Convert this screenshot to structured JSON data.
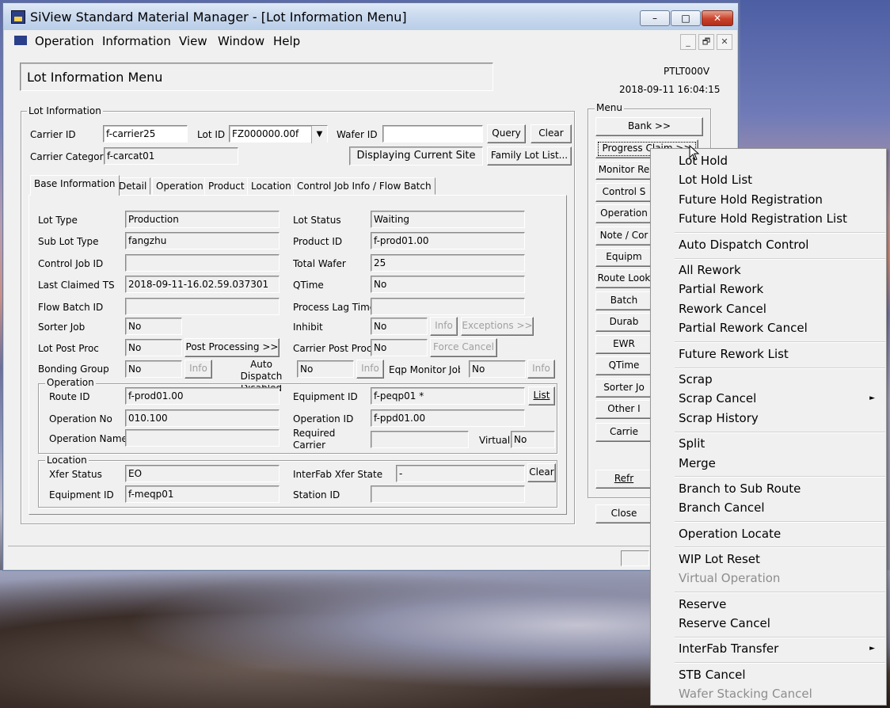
{
  "window": {
    "title": "SiView Standard Material Manager - [Lot Information Menu]",
    "menus": [
      "Operation",
      "Information",
      "View",
      "Window",
      "Help"
    ],
    "min": "–",
    "max": "□",
    "close": "✕",
    "mdi_min": "_",
    "mdi_restore": "🗗",
    "mdi_close": "✕"
  },
  "header": {
    "panel_title": "Lot Information Menu",
    "screen_id": "PTLT000V",
    "timestamp": "2018-09-11 16:04:15"
  },
  "lot_info": {
    "legend": "Lot Information",
    "carrier_id_label": "Carrier ID",
    "carrier_id": "f-carrier25",
    "lot_id_label": "Lot ID",
    "lot_id": "FZ000000.00f",
    "wafer_id_label": "Wafer ID",
    "wafer_id": "",
    "query": "Query",
    "clear": "Clear",
    "carrier_category_label": "Carrier Category",
    "carrier_category": "f-carcat01",
    "displaying": "Displaying Current Site",
    "family_lot_list": "Family Lot List..."
  },
  "tabs": [
    "Base Information",
    "Detail",
    "Operation",
    "Product",
    "Location",
    "Control Job Info / Flow Batch"
  ],
  "base": {
    "lot_type_label": "Lot Type",
    "lot_type": "Production",
    "lot_status_label": "Lot Status",
    "lot_status": "Waiting",
    "sub_lot_type_label": "Sub Lot Type",
    "sub_lot_type": "fangzhu",
    "product_id_label": "Product ID",
    "product_id": "f-prod01.00",
    "control_job_id_label": "Control Job ID",
    "control_job_id": "",
    "total_wafer_label": "Total Wafer",
    "total_wafer": "25",
    "last_claimed_label": "Last Claimed TS",
    "last_claimed": "2018-09-11-16.02.59.037301",
    "qtime_label": "QTime",
    "qtime": "No",
    "flow_batch_label": "Flow Batch ID",
    "flow_batch": "",
    "process_lag_label": "Process Lag Time",
    "process_lag": "",
    "sorter_job_label": "Sorter Job",
    "sorter_job": "No",
    "inhibit_label": "Inhibit",
    "inhibit": "No",
    "inhibit_info": "Info",
    "exceptions": "Exceptions >>",
    "lot_post_proc_label": "Lot Post Proc",
    "lot_post_proc": "No",
    "post_processing": "Post Processing >>",
    "carrier_post_proc_label": "Carrier Post Proc",
    "carrier_post_proc": "No",
    "force_cancel": "Force Cancel",
    "bonding_group_label": "Bonding Group",
    "bonding_group": "No",
    "bonding_info": "Info",
    "auto_dispatch_label": "Auto Dispatch Disabled",
    "auto_dispatch": "No",
    "auto_dispatch_info": "Info",
    "eqp_monitor_label": "Eqp Monitor Job",
    "eqp_monitor": "No",
    "eqp_monitor_info": "Info"
  },
  "operation_group": {
    "legend": "Operation",
    "route_id_label": "Route ID",
    "route_id": "f-prod01.00",
    "equipment_id_label": "Equipment ID",
    "equipment_id": "f-peqp01 *",
    "list": "List",
    "operation_no_label": "Operation No",
    "operation_no": "010.100",
    "operation_id_label": "Operation ID",
    "operation_id": "f-ppd01.00",
    "operation_name_label": "Operation Name",
    "operation_name": "",
    "required_carrier_label": "Required Carrier",
    "required_carrier": "",
    "virtual_label": "Virtual",
    "virtual": "No"
  },
  "location_group": {
    "legend": "Location",
    "xfer_status_label": "Xfer Status",
    "xfer_status": "EO",
    "interfab_label": "InterFab Xfer State",
    "interfab": "-",
    "clear": "Clear",
    "equipment_id_label": "Equipment ID",
    "equipment_id": "f-meqp01",
    "station_id_label": "Station ID",
    "station_id": ""
  },
  "side_menu": {
    "legend": "Menu",
    "buttons": [
      "Bank >>",
      "Progress Claim >>",
      "Monitor Re",
      "Control S",
      "Operation",
      "Note / Cor",
      "Equipm",
      "Route Look",
      "Batch",
      "Durab",
      "EWR",
      "QTime",
      "Sorter Jo",
      "Other I",
      "Carrie"
    ],
    "refresh": "Refr",
    "close": "Close"
  },
  "context_menu": {
    "items": [
      {
        "label": "Lot Hold",
        "disabled": false
      },
      {
        "label": "Lot Hold List",
        "disabled": false
      },
      {
        "label": "Future Hold Registration",
        "disabled": false
      },
      {
        "label": "Future Hold Registration List",
        "disabled": false
      },
      {
        "label": "Auto Dispatch Control",
        "disabled": false
      },
      {
        "label": "All Rework",
        "disabled": false
      },
      {
        "label": "Partial Rework",
        "disabled": false
      },
      {
        "label": "Rework Cancel",
        "disabled": false
      },
      {
        "label": "Partial Rework Cancel",
        "disabled": false
      },
      {
        "label": "Future Rework List",
        "disabled": false
      },
      {
        "label": "Scrap",
        "disabled": false
      },
      {
        "label": "Scrap Cancel",
        "disabled": false,
        "submenu": true
      },
      {
        "label": "Scrap History",
        "disabled": false
      },
      {
        "label": "Split",
        "disabled": false
      },
      {
        "label": "Merge",
        "disabled": false
      },
      {
        "label": "Branch to Sub Route",
        "disabled": false
      },
      {
        "label": "Branch Cancel",
        "disabled": false
      },
      {
        "label": "Operation Locate",
        "disabled": false
      },
      {
        "label": "WIP Lot Reset",
        "disabled": false
      },
      {
        "label": "Virtual Operation",
        "disabled": true
      },
      {
        "label": "Reserve",
        "disabled": false
      },
      {
        "label": "Reserve Cancel",
        "disabled": false
      },
      {
        "label": "InterFab Transfer",
        "disabled": false,
        "submenu": true
      },
      {
        "label": "STB Cancel",
        "disabled": false
      },
      {
        "label": "Wafer Stacking Cancel",
        "disabled": true
      }
    ],
    "submenu_arrow": "►"
  }
}
